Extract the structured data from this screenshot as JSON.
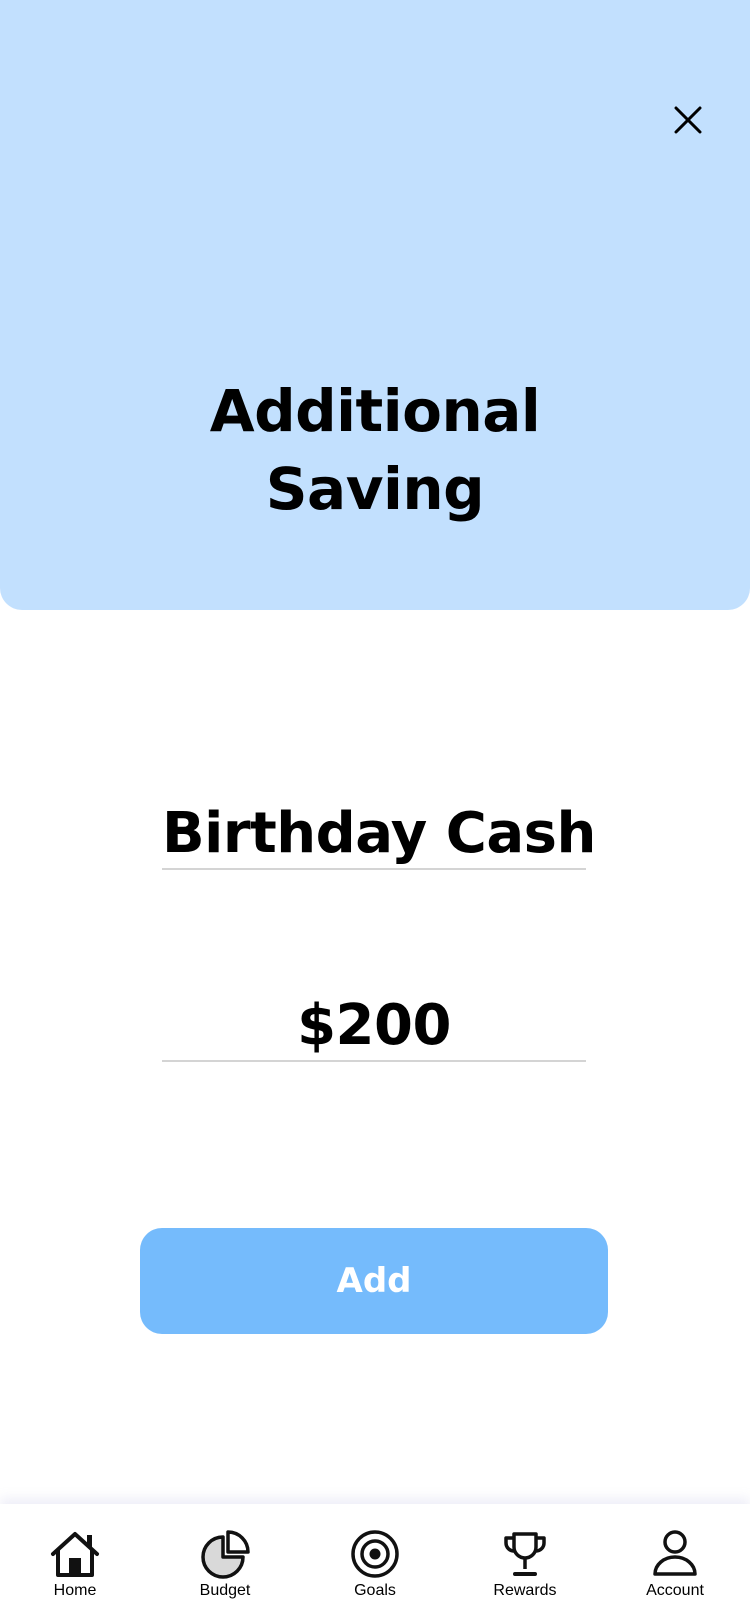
{
  "header": {
    "title_line1": "Additional",
    "title_line2": "Saving",
    "background_color": "#c2e0fe",
    "close_icon": "close-icon"
  },
  "form": {
    "name_value": "Birthday Cash",
    "amount_value": "$200"
  },
  "actions": {
    "add_label": "Add",
    "add_color": "#75bbfc"
  },
  "tab_bar": {
    "items": [
      {
        "label": "Home",
        "icon": "home-icon"
      },
      {
        "label": "Budget",
        "icon": "pie-chart-icon"
      },
      {
        "label": "Goals",
        "icon": "target-icon"
      },
      {
        "label": "Rewards",
        "icon": "trophy-icon"
      },
      {
        "label": "Account",
        "icon": "person-icon"
      }
    ]
  }
}
